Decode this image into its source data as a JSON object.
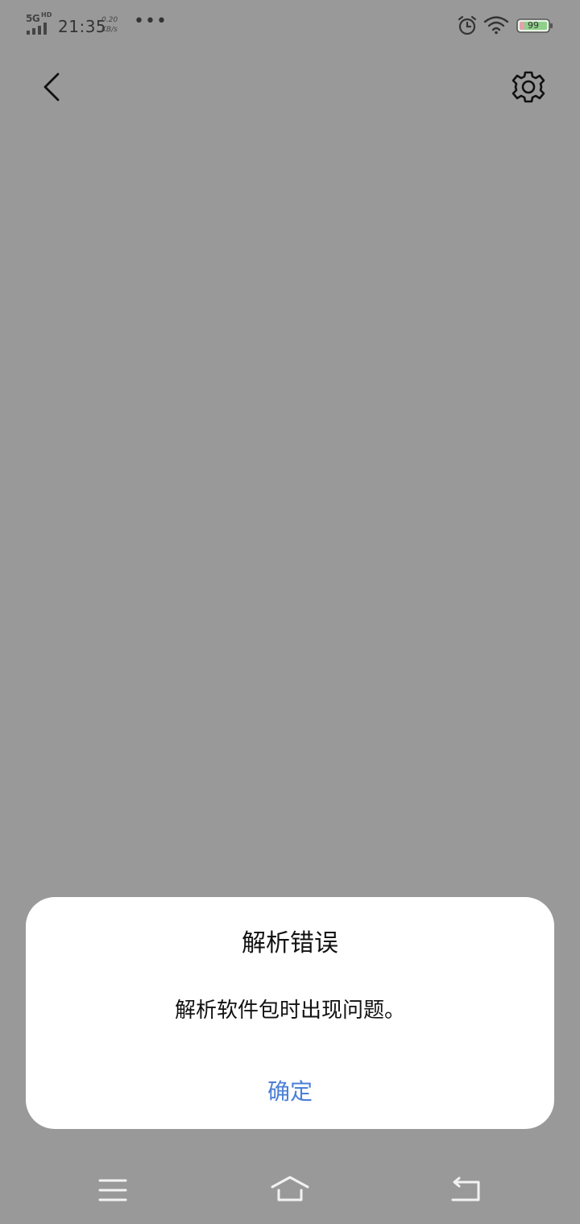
{
  "status_bar": {
    "network": "5G",
    "network_sub": "HD",
    "time": "21:35",
    "speed_value": "0.20",
    "speed_unit": "KB/s",
    "more": "•••",
    "battery": "99",
    "icons": {
      "signal": "signal-icon",
      "alarm": "alarm-icon",
      "wifi": "wifi-icon",
      "battery": "battery-icon"
    }
  },
  "toolbar": {
    "back_icon": "back-arrow-icon",
    "settings_icon": "gear-icon"
  },
  "dialog": {
    "title": "解析错误",
    "message": "解析软件包时出现问题。",
    "confirm_label": "确定"
  },
  "nav_bar": {
    "menu_icon": "menu-icon",
    "home_icon": "home-icon",
    "back_icon": "return-icon"
  },
  "colors": {
    "overlay_background": "#999999",
    "dialog_background": "#ffffff",
    "accent": "#4b7fd6",
    "text": "#111111"
  }
}
